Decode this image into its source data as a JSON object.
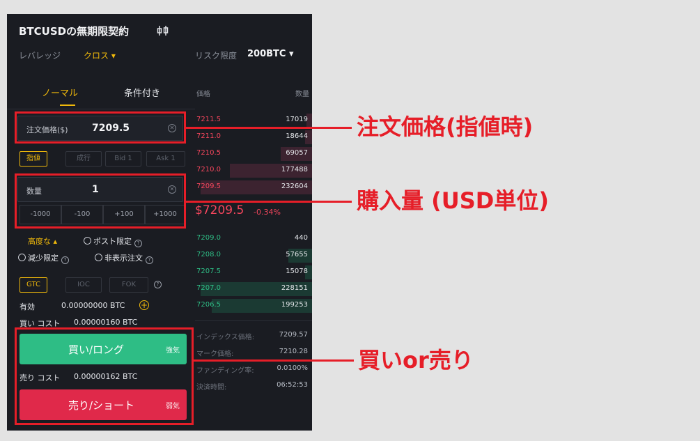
{
  "header": {
    "title": "BTCUSDの無期限契約",
    "leverage_label": "レバレッジ",
    "leverage_value": "クロス",
    "risk_label": "リスク限度",
    "risk_value": "200BTC"
  },
  "tabs": [
    {
      "label": "ノーマル",
      "active": true
    },
    {
      "label": "条件付き",
      "active": false
    }
  ],
  "order_form": {
    "price_label": "注文価格($)",
    "price_value": "7209.5",
    "price_buttons": [
      "指値",
      "成行",
      "Bid 1",
      "Ask 1"
    ],
    "qty_label": "数量",
    "qty_value": "1",
    "qty_buttons": [
      "-1000",
      "-100",
      "+100",
      "+1000"
    ],
    "advanced_label": "高度な",
    "post_only_label": "ポスト限定",
    "reduce_only_label": "減少限定",
    "hidden_label": "非表示注文",
    "tif_buttons": [
      "GTC",
      "IOC",
      "FOK"
    ],
    "available_label": "有効",
    "available_value": "0.00000000  BTC",
    "buy_cost_label": "買い コスト",
    "buy_cost_value": "0.00000160 BTC",
    "buy_button": "買い/ロング",
    "buy_tag": "強気",
    "sell_cost_label": "売り コスト",
    "sell_cost_value": "0.00000162 BTC",
    "sell_button": "売り/ショート",
    "sell_tag": "弱気"
  },
  "orderbook": {
    "price_header": "価格",
    "amount_header": "数量",
    "asks": [
      {
        "price": "7211.5",
        "amount": "17019",
        "depth": 0.05
      },
      {
        "price": "7211.0",
        "amount": "18644",
        "depth": 0.06
      },
      {
        "price": "7210.5",
        "amount": "69057",
        "depth": 0.27
      },
      {
        "price": "7210.0",
        "amount": "177488",
        "depth": 0.7
      },
      {
        "price": "7209.5",
        "amount": "232604",
        "depth": 0.95
      }
    ],
    "last_price": "$7209.5",
    "last_change": "-0.34%",
    "bids": [
      {
        "price": "7209.0",
        "amount": "440",
        "depth": 0.0
      },
      {
        "price": "7208.0",
        "amount": "57655",
        "depth": 0.2
      },
      {
        "price": "7207.5",
        "amount": "15078",
        "depth": 0.06
      },
      {
        "price": "7207.0",
        "amount": "228151",
        "depth": 0.95
      },
      {
        "price": "7206.5",
        "amount": "199253",
        "depth": 0.86
      }
    ],
    "index_label": "インデックス価格:",
    "index_value": "7209.57",
    "mark_label": "マーク価格:",
    "mark_value": "7210.28",
    "funding_label": "ファンディング率:",
    "funding_value": "0.0100%",
    "settle_label": "決済時間:",
    "settle_value": "06:52:53"
  },
  "annotations": {
    "price": "注文価格(指値時)",
    "qty": "購入量 (USD単位)",
    "buysell": "買いor売り"
  },
  "colors": {
    "accent": "#f0b90b",
    "buy": "#2ebd85",
    "sell": "#e0294a",
    "highlight": "#e61e28"
  }
}
